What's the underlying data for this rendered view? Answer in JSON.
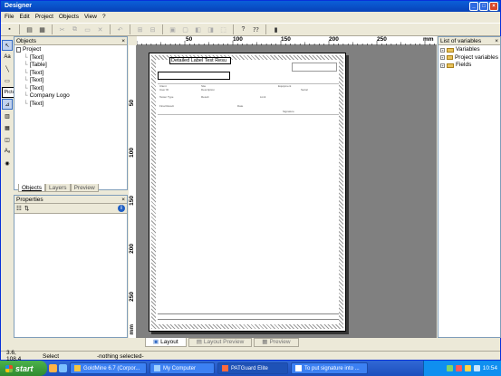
{
  "window": {
    "title": "Designer"
  },
  "menu": [
    "File",
    "Edit",
    "Project",
    "Objects",
    "View",
    "?"
  ],
  "toolbar": {
    "icons": [
      "save-icon",
      "print-icon",
      "print-preview-icon",
      "cut-icon",
      "copy-icon",
      "paste-icon",
      "delete-icon",
      "undo-icon",
      "align-icon",
      "arrange-icon",
      "group-icon",
      "ungroup-icon",
      "help-icon",
      "context-help-icon",
      "exit-icon"
    ]
  },
  "tools": {
    "text_label": "Aa",
    "picture_label": "Picture"
  },
  "objects_panel": {
    "title": "Objects",
    "items": [
      "Project",
      "[Text]",
      "[Table]",
      "[Text]",
      "[Text]",
      "[Text]",
      "Company Logo",
      "[Text]"
    ],
    "tabs": [
      "Objects",
      "Layers",
      "Preview"
    ]
  },
  "properties_panel": {
    "title": "Properties"
  },
  "ruler": {
    "h_labels": [
      "50",
      "100",
      "150",
      "200",
      "250",
      "mm"
    ],
    "v_labels": [
      "50",
      "100",
      "150",
      "200",
      "250",
      "mm"
    ]
  },
  "report": {
    "header_label": "Detailed Label Test Resu",
    "rows": [
      [
        "Client",
        "Site",
        "Equipment"
      ],
      [
        "User ID",
        "Description",
        "Serial"
      ],
      [
        "Tester Type",
        "Result",
        "Limit"
      ],
      [
        "Final Result",
        "Date",
        "Signature"
      ]
    ]
  },
  "variables_panel": {
    "title": "List of variables",
    "items": [
      "Variables",
      "Project variables",
      "Fields"
    ]
  },
  "bottom_tabs": [
    "Layout",
    "Layout Preview",
    "Preview"
  ],
  "status": {
    "coords": "3.6, 108.4",
    "mode": "Select",
    "selection": "-nothing selected-"
  },
  "taskbar": {
    "start_label": "start",
    "tasks": [
      "GoldMine 6.7 (Corpor...",
      "My Computer",
      "PATGuard Elite",
      "To put signature into ..."
    ],
    "clock": "10:54"
  },
  "colors": {
    "accent": "#316ac5",
    "taskbar": "#245edb",
    "start": "#3c9a3c"
  }
}
